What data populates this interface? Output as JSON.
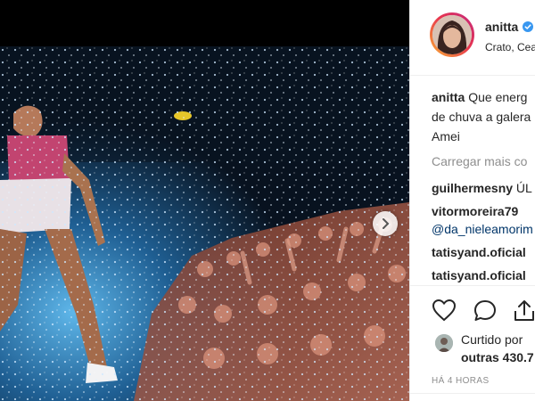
{
  "post": {
    "username": "anitta",
    "location": "Crato, Cea",
    "caption": {
      "author": "anitta",
      "line1": "Que energ",
      "line2": "de chuva a galera",
      "line3": "Amei"
    },
    "load_more": "Carregar mais co",
    "comments": [
      {
        "author": "guilhermesny",
        "text": "ÚL"
      },
      {
        "author": "vitormoreira79",
        "text": ""
      },
      {
        "author": "",
        "text": "@da_nieleamorim"
      },
      {
        "author": "tatisyand.oficial",
        "text": ""
      },
      {
        "author": "tatisyand.oficial",
        "text": ""
      }
    ],
    "likes_line1": "Curtido por",
    "likes_line2": "outras 430.7",
    "timestamp": "HÁ 4 HORAS"
  },
  "icons": {
    "verified": "verified-badge-icon",
    "like": "heart-icon",
    "comment": "comment-icon",
    "share": "share-icon",
    "next": "chevron-right-icon"
  },
  "colors": {
    "verified": "#3897f0",
    "mention": "#003569",
    "muted": "#8e8e8e"
  }
}
